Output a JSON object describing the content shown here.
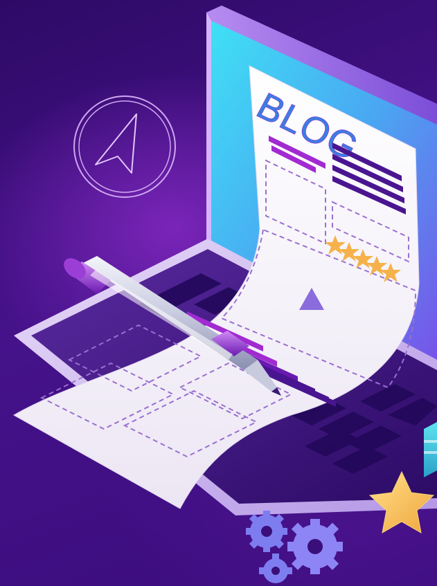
{
  "illustration": {
    "blog_title": "BLOG",
    "rating_stars": 5,
    "colors": {
      "background": "#3a0f7a",
      "screen_gradient_top": "#33d6f2",
      "screen_gradient_bottom": "#6a5cf0",
      "paper": "#f4f1f8",
      "dash_lines": "#9a6fd0",
      "text_bars_dark": "#4a1590",
      "text_bars_magenta": "#a12ad0",
      "rating_star": "#f5b24a",
      "gear": "#7d7df0",
      "big_star": "#f7c15a"
    },
    "icons": [
      "compass-cursor-icon",
      "pen-icon",
      "gear-icon",
      "star-icon",
      "play-triangle-icon"
    ]
  }
}
